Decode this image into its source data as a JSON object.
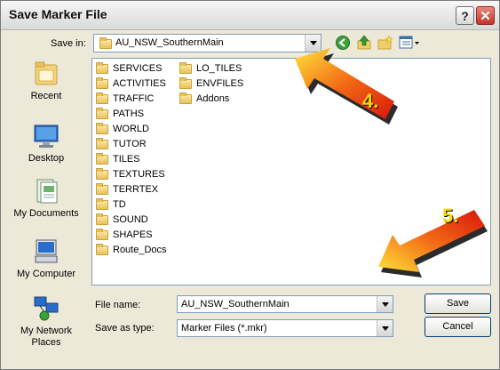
{
  "window": {
    "title": "Save Marker File",
    "help_symbol": "?",
    "close_symbol": "✕"
  },
  "toolbar": {
    "save_in_label": "Save in:",
    "save_in_value": "AU_NSW_SouthernMain"
  },
  "places": [
    {
      "label": "Recent",
      "icon": "recent-icon"
    },
    {
      "label": "Desktop",
      "icon": "desktop-icon"
    },
    {
      "label": "My Documents",
      "icon": "my-documents-icon"
    },
    {
      "label": "My Computer",
      "icon": "my-computer-icon"
    },
    {
      "label": "My Network Places",
      "icon": "network-places-icon"
    }
  ],
  "files": {
    "col1": [
      "SERVICES",
      "ACTIVITIES",
      "TRAFFIC",
      "PATHS",
      "WORLD",
      "TUTOR",
      "TILES",
      "TEXTURES",
      "TERRTEX",
      "TD",
      "SOUND",
      "SHAPES",
      "Route_Docs"
    ],
    "col2": [
      "LO_TILES",
      "ENVFILES",
      "Addons"
    ]
  },
  "form": {
    "file_name_label": "File name:",
    "file_name_value": "AU_NSW_SouthernMain",
    "save_type_label": "Save as type:",
    "save_type_value": "Marker Files (*.mkr)"
  },
  "buttons": {
    "save": "Save",
    "cancel": "Cancel"
  },
  "annotations": {
    "step4": "4.",
    "step5": "5.",
    "arrow_color": "#f23a12",
    "label_color": "#ffd800"
  }
}
